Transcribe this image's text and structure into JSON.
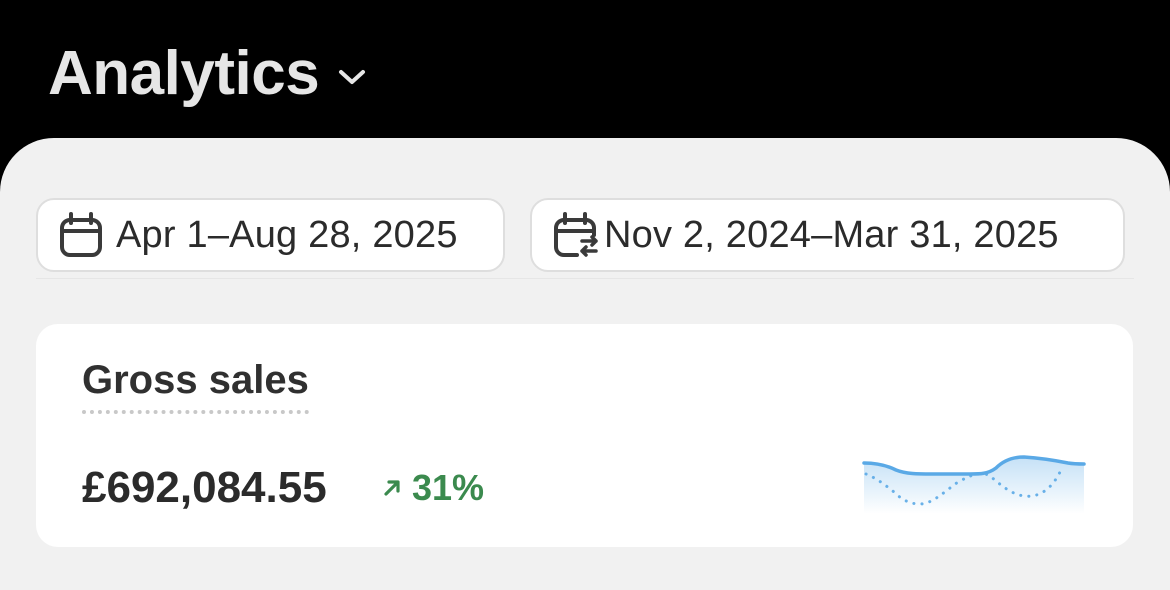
{
  "header": {
    "title": "Analytics",
    "chevron_icon": "chevron-down-icon"
  },
  "date_filters": {
    "primary": {
      "icon": "calendar-icon",
      "label": "Apr 1–Aug 28, 2025"
    },
    "comparison": {
      "icon": "calendar-compare-icon",
      "label": "Nov 2, 2024–Mar 31, 2025"
    }
  },
  "metric": {
    "title": "Gross sales",
    "value": "£692,084.55",
    "change": "31%",
    "change_direction": "up",
    "change_icon": "arrow-up-right-icon"
  },
  "colors": {
    "background": "#000000",
    "sheet": "#f1f1f1",
    "card": "#ffffff",
    "positive": "#3b8a4e",
    "sparkline": "#5aa9e6"
  }
}
